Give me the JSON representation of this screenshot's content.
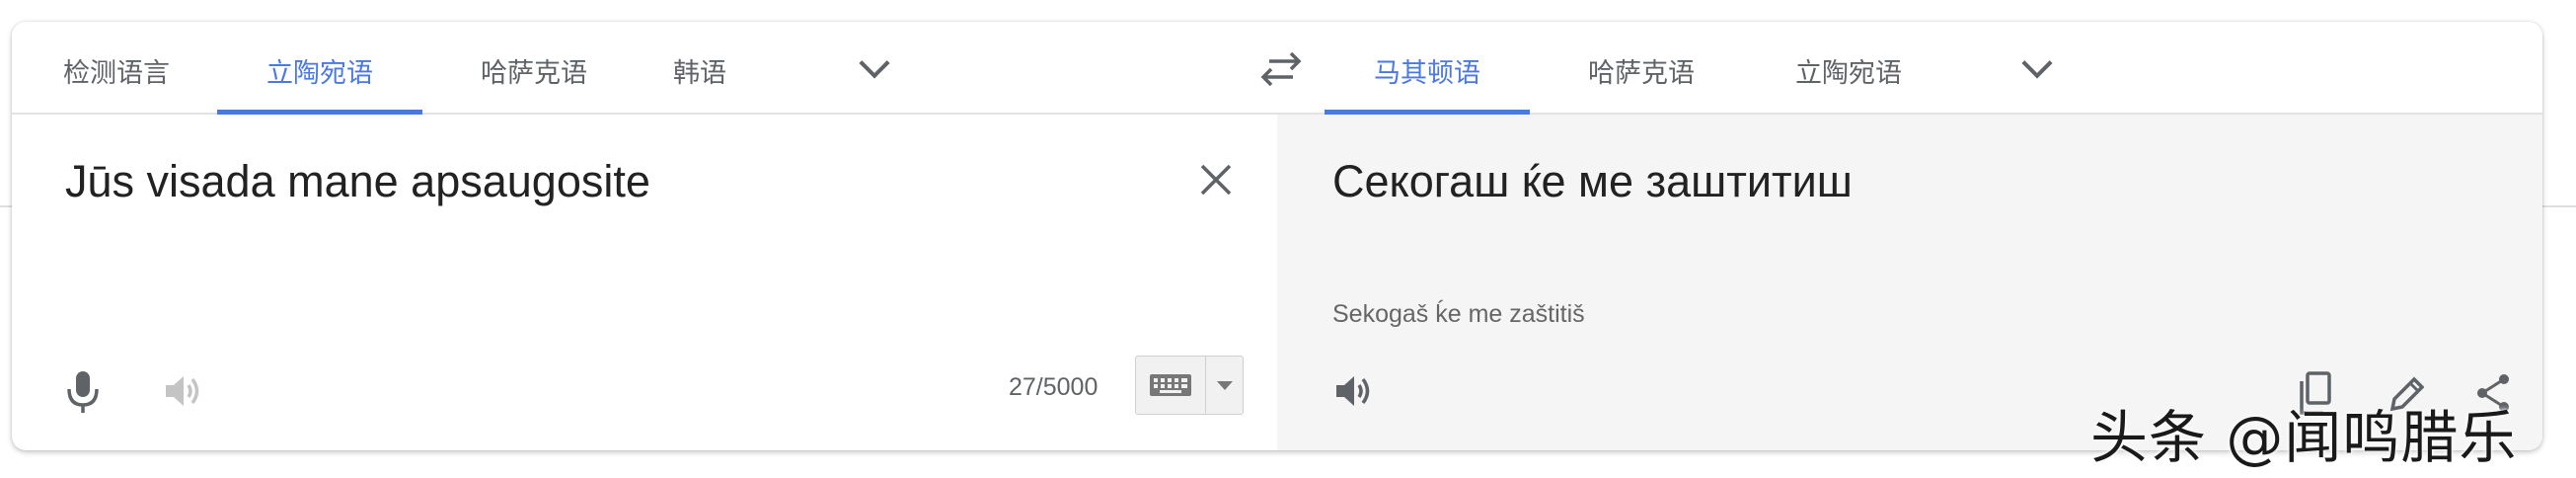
{
  "source": {
    "tabs": [
      {
        "label": "检测语言",
        "active": false
      },
      {
        "label": "立陶宛语",
        "active": true
      },
      {
        "label": "哈萨克语",
        "active": false
      },
      {
        "label": "韩语",
        "active": false
      }
    ],
    "text": "Jūs visada mane apsaugosite",
    "char_count": "27/5000"
  },
  "target": {
    "tabs": [
      {
        "label": "马其顿语",
        "active": true
      },
      {
        "label": "哈萨克语",
        "active": false
      },
      {
        "label": "立陶宛语",
        "active": false
      }
    ],
    "text": "Секогаш ќе ме заштитиш",
    "transliteration": "Sekogaš ḱe me zaštitiš"
  },
  "icons": {
    "more_source": "chevron-down-icon",
    "swap": "swap-languages-icon",
    "more_target": "chevron-down-icon",
    "clear": "close-icon",
    "mic": "microphone-icon",
    "listen_source": "speaker-icon",
    "keyboard": "keyboard-icon",
    "listen_target": "speaker-icon",
    "copy": "copy-icon",
    "edit": "pencil-icon",
    "share": "share-icon"
  },
  "colors": {
    "accent": "#4a79e0",
    "text": "#222222",
    "muted": "#5f6368",
    "target_pane_bg": "#f5f5f5"
  },
  "watermark": "头条 @闻鸣腊乐"
}
